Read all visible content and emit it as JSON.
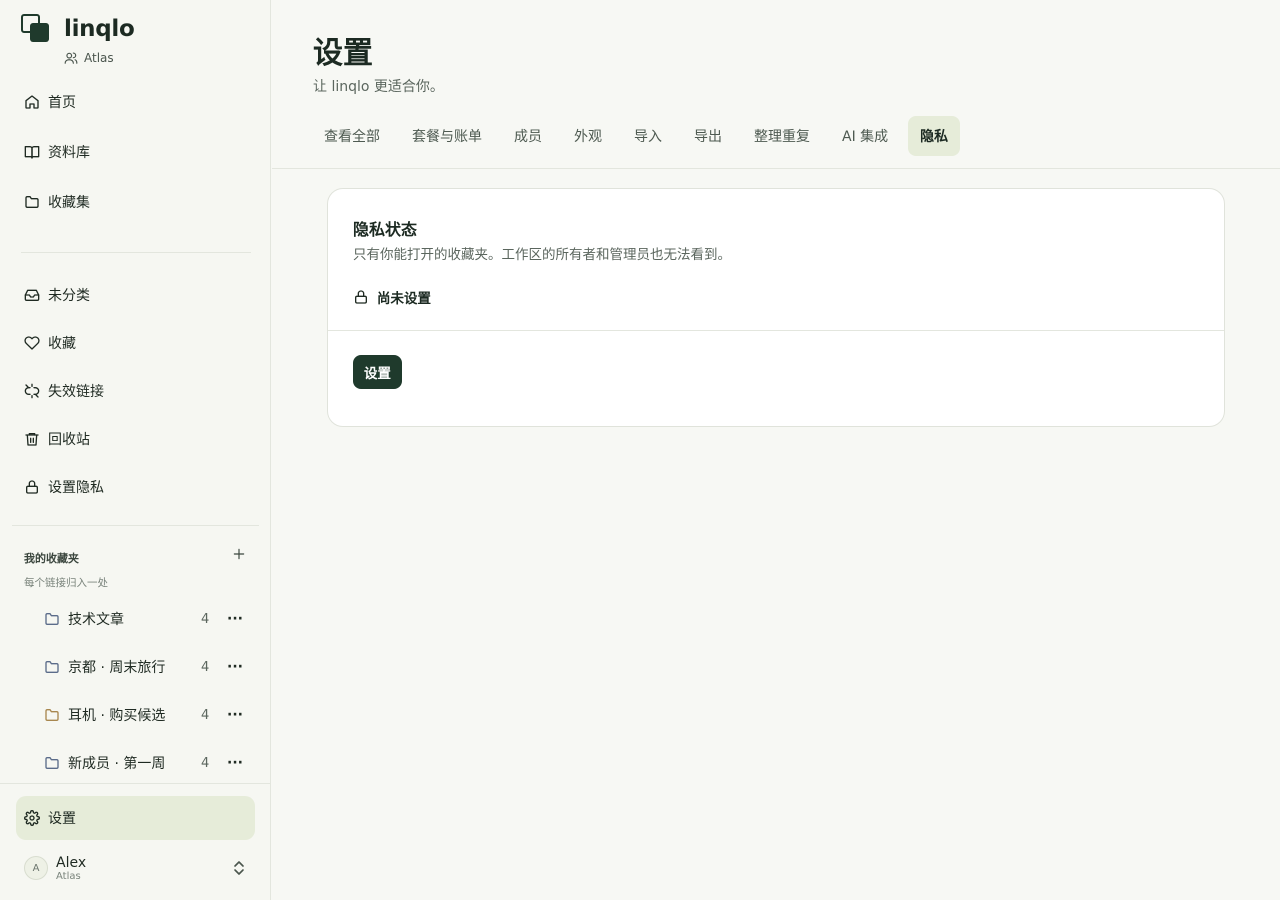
{
  "app": {
    "name": "linqlo",
    "workspace": "Atlas"
  },
  "sidebar": {
    "primary": [
      {
        "label": "首页",
        "icon": "home-icon"
      },
      {
        "label": "资料库",
        "icon": "book-icon"
      },
      {
        "label": "收藏集",
        "icon": "folder-icon"
      }
    ],
    "secondary": [
      {
        "label": "未分类",
        "icon": "inbox-icon"
      },
      {
        "label": "收藏",
        "icon": "heart-icon"
      },
      {
        "label": "失效链接",
        "icon": "broken-link-icon"
      },
      {
        "label": "回收站",
        "icon": "trash-icon"
      },
      {
        "label": "设置隐私",
        "icon": "lock-icon"
      }
    ],
    "favorites": {
      "title": "我的收藏夹",
      "subtitle": "每个链接归入一处",
      "add_icon": "plus-icon",
      "items": [
        {
          "label": "技术文章",
          "count": "4",
          "color": "#5b6c8a"
        },
        {
          "label": "京都 · 周末旅行",
          "count": "4",
          "color": "#5b6c8a"
        },
        {
          "label": "耳机 · 购买候选",
          "count": "4",
          "color": "#a8874f"
        },
        {
          "label": "新成员 · 第一周",
          "count": "4",
          "color": "#5b6c8a"
        }
      ]
    },
    "settings_label": "设置",
    "user": {
      "initial": "A",
      "name": "Alex",
      "workspace": "Atlas"
    }
  },
  "main": {
    "title": "设置",
    "subtitle": "让 linqlo 更适合你。",
    "tabs": [
      {
        "label": "查看全部",
        "active": false
      },
      {
        "label": "套餐与账单",
        "active": false
      },
      {
        "label": "成员",
        "active": false
      },
      {
        "label": "外观",
        "active": false
      },
      {
        "label": "导入",
        "active": false
      },
      {
        "label": "导出",
        "active": false
      },
      {
        "label": "整理重复",
        "active": false
      },
      {
        "label": "AI 集成",
        "active": false
      },
      {
        "label": "隐私",
        "active": true
      }
    ],
    "card": {
      "title": "隐私状态",
      "description": "只有你能打开的收藏夹。工作区的所有者和管理员也无法看到。",
      "status": "尚未设置",
      "button": "设置"
    }
  },
  "colors": {
    "accent": "#1f3a2c",
    "active_bg": "#e6ecd9",
    "background": "#f7f8f4"
  }
}
